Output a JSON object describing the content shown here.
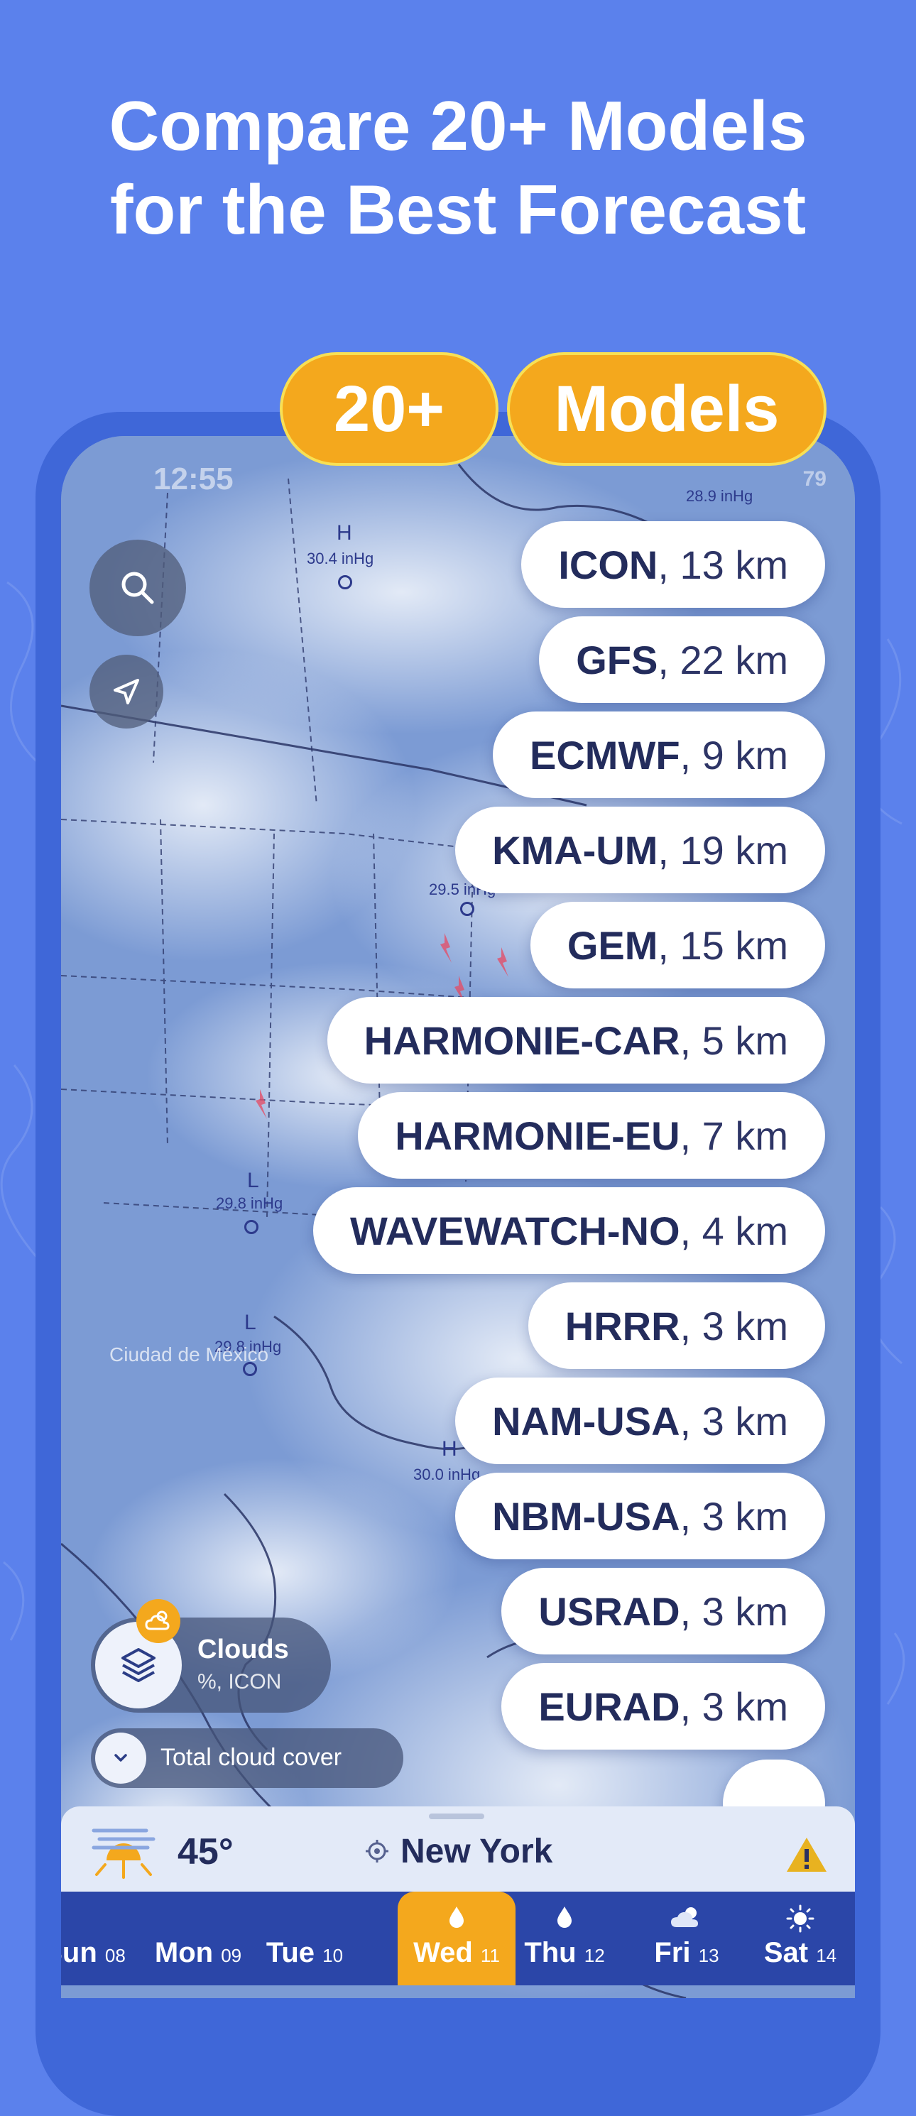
{
  "headline": {
    "line1": "Compare 20+ Models",
    "line2": "for the Best Forecast"
  },
  "badges": {
    "count": "20+",
    "label": "Models"
  },
  "status_bar": {
    "time": "12:55",
    "battery": "79"
  },
  "map": {
    "labels": {
      "pressure_ne": "28.9 inHg",
      "high1_letter": "H",
      "high1_value": "30.4 inHg",
      "mid_value": "29.5 inHg",
      "low1_letter": "L",
      "low1_value": "29.8 inHg",
      "low2_letter": "L",
      "low2_value": "29.8 inHg",
      "high2_letter": "H",
      "high2_value": "30.0 inHg",
      "city": "Ciudad de México"
    }
  },
  "models": [
    {
      "name": "ICON",
      "res": ", 13 km"
    },
    {
      "name": "GFS",
      "res": ", 22 km"
    },
    {
      "name": "ECMWF",
      "res": ", 9 km"
    },
    {
      "name": "KMA-UM",
      "res": ", 19 km"
    },
    {
      "name": "GEM",
      "res": ", 15 km"
    },
    {
      "name": "HARMONIE-CAR",
      "res": ", 5 km"
    },
    {
      "name": "HARMONIE-EU",
      "res": ", 7 km"
    },
    {
      "name": "WAVEWATCH-NO",
      "res": ", 4 km"
    },
    {
      "name": "HRRR",
      "res": ", 3 km"
    },
    {
      "name": "NAM-USA",
      "res": ", 3 km"
    },
    {
      "name": "NBM-USA",
      "res": ", 3 km"
    },
    {
      "name": "USRAD",
      "res": ", 3 km"
    },
    {
      "name": "EURAD",
      "res": ", 3 km"
    }
  ],
  "more_label": "...",
  "layer": {
    "title": "Clouds",
    "subtitle": "%, ICON",
    "cover_label": "Total cloud cover"
  },
  "weather": {
    "temperature": "45°",
    "location": "New York"
  },
  "days": [
    {
      "name": "Sun",
      "num": "08"
    },
    {
      "name": "Mon",
      "num": "09"
    },
    {
      "name": "Tue",
      "num": "10"
    },
    {
      "name": "Wed",
      "num": "11"
    },
    {
      "name": "Thu",
      "num": "12"
    },
    {
      "name": "Fri",
      "num": "13"
    },
    {
      "name": "Sat",
      "num": "14"
    }
  ],
  "colors": {
    "background": "#5b81ec",
    "accent": "#f4a81d",
    "pill_text": "#232c5c",
    "day_bar": "#2b46a8"
  }
}
